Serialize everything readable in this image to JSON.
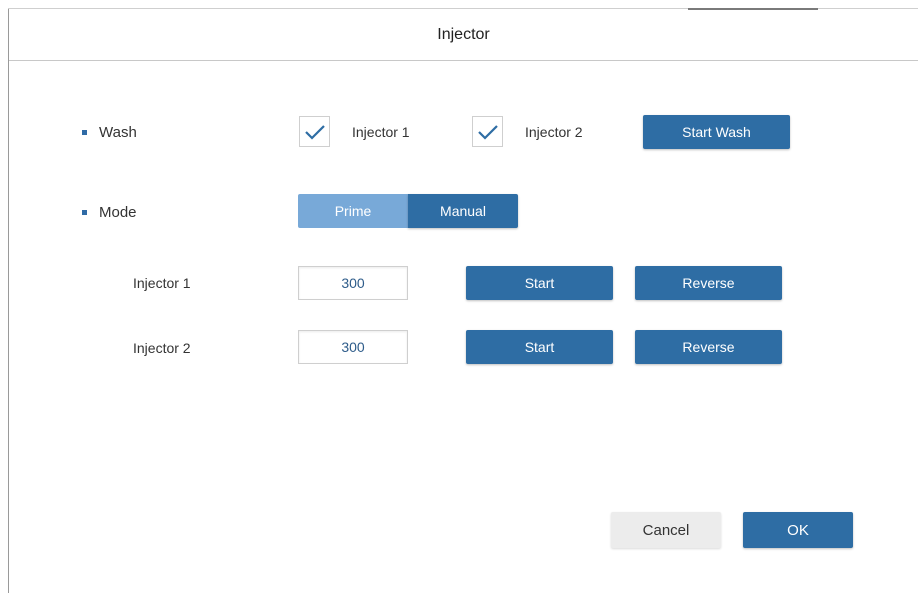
{
  "dialog": {
    "title": "Injector"
  },
  "wash": {
    "label": "Wash",
    "injector1": {
      "label": "Injector 1",
      "checked": true
    },
    "injector2": {
      "label": "Injector 2",
      "checked": true
    },
    "start_wash_label": "Start Wash"
  },
  "mode": {
    "label": "Mode",
    "options": [
      "Prime",
      "Manual"
    ],
    "selected": "Manual"
  },
  "injectors": [
    {
      "label": "Injector 1",
      "value": "300",
      "start_label": "Start",
      "reverse_label": "Reverse"
    },
    {
      "label": "Injector 2",
      "value": "300",
      "start_label": "Start",
      "reverse_label": "Reverse"
    }
  ],
  "footer": {
    "cancel_label": "Cancel",
    "ok_label": "OK"
  },
  "colors": {
    "accent": "#2e6da4",
    "accent_light": "#78a9d8",
    "bullet": "#2f6ba6",
    "secondary_button": "#ececec"
  },
  "icons": {
    "checkbox_check": "check-icon",
    "bullet": "bullet-icon"
  }
}
